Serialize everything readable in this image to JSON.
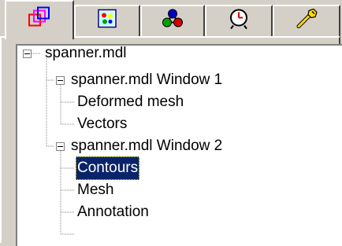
{
  "tabs": [
    {
      "icon": "overlapping-squares-icon",
      "active": true
    },
    {
      "icon": "color-palette-icon",
      "active": false
    },
    {
      "icon": "molecule-icon",
      "active": false
    },
    {
      "icon": "clock-icon",
      "active": false
    },
    {
      "icon": "wrench-icon",
      "active": false
    }
  ],
  "tree": {
    "root": {
      "label": "spanner.mdl",
      "expanded": true,
      "children": [
        {
          "label": "spanner.mdl Window 1",
          "expanded": true,
          "children": [
            {
              "label": "Deformed mesh"
            },
            {
              "label": "Vectors"
            }
          ]
        },
        {
          "label": "spanner.mdl Window 2",
          "expanded": true,
          "children": [
            {
              "label": "Contours",
              "selected": true
            },
            {
              "label": "Mesh"
            },
            {
              "label": "Annotation"
            }
          ]
        }
      ]
    }
  },
  "colors": {
    "selection": "#0a246a",
    "face": "#d4d0c8"
  }
}
